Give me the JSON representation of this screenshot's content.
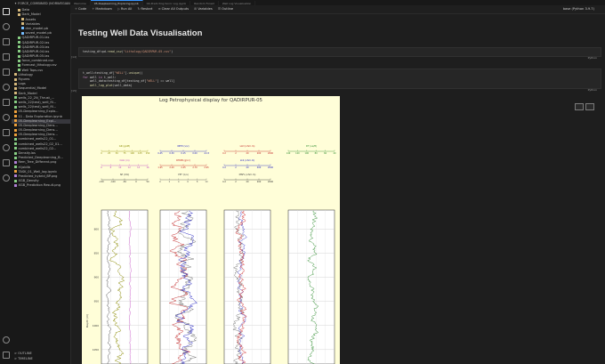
{
  "window": {
    "tabs": [
      {
        "label": "Welcome",
        "active": false
      },
      {
        "label": "05-Deeplearning_Exploring.ipynb",
        "active": true
      },
      {
        "label": "04-Predicting Sonic Log.ipynb",
        "active": false
      },
      {
        "label": "Random Forest",
        "active": false
      },
      {
        "label": "Well Log Visualisation",
        "active": false
      }
    ]
  },
  "toolbar": {
    "code_label": "Code",
    "markdown_label": "Markdown",
    "run_all_label": "Run All",
    "restart_label": "Restart",
    "clear_outputs_label": "Clear All Outputs",
    "variables_label": "Variables",
    "outline_label": "Outline",
    "kernel_label": "base (Python 3.9.7)"
  },
  "sidebar": {
    "title": "✦ FORCE_COMBINED (NORWEGIAN BASE)",
    "items": [
      {
        "label": "Data",
        "indent": 1,
        "color": "#d7ba7d",
        "selected": false
      },
      {
        "label": "Dark_Model",
        "indent": 1,
        "color": "#d7ba7d",
        "selected": false
      },
      {
        "label": "Assets",
        "indent": 2,
        "color": "#d7ba7d",
        "selected": false
      },
      {
        "label": "Variables",
        "indent": 2,
        "color": "#d7ba7d",
        "selected": false
      },
      {
        "label": "dnn_model.pb",
        "indent": 2,
        "color": "#75beff",
        "selected": false
      },
      {
        "label": "saved_model.pb",
        "indent": 2,
        "color": "#75beff",
        "selected": false
      },
      {
        "label": "QADIRPUR-01.las",
        "indent": 1,
        "color": "#89d185",
        "selected": false
      },
      {
        "label": "QADIRPUR-02.las",
        "indent": 1,
        "color": "#89d185",
        "selected": false
      },
      {
        "label": "QADIRPUR-03.las",
        "indent": 1,
        "color": "#89d185",
        "selected": false
      },
      {
        "label": "QADIRPUR-04.las",
        "indent": 1,
        "color": "#89d185",
        "selected": false
      },
      {
        "label": "QADIRPUR-05.las",
        "indent": 1,
        "color": "#89d185",
        "selected": false
      },
      {
        "label": "force_combined.csv",
        "indent": 1,
        "color": "#89d185",
        "selected": false
      },
      {
        "label": "Forecast_lithology.csv",
        "indent": 1,
        "color": "#89d185",
        "selected": false
      },
      {
        "label": "Well Tops.csv",
        "indent": 1,
        "color": "#89d185",
        "selected": false
      },
      {
        "label": "Lithology",
        "indent": 0,
        "color": "#d7ba7d",
        "selected": false
      },
      {
        "label": "Figures",
        "indent": 0,
        "color": "#d7ba7d",
        "selected": false
      },
      {
        "label": "Logs",
        "indent": 0,
        "color": "#d7ba7d",
        "selected": false
      },
      {
        "label": "Sequential_Model",
        "indent": 0,
        "color": "#d7ba7d",
        "selected": false
      },
      {
        "label": "Dark_Model",
        "indent": 0,
        "color": "#d7ba7d",
        "selected": false
      },
      {
        "label": "wells_22_2N_Thrust_...",
        "indent": 0,
        "color": "#89d185",
        "selected": false
      },
      {
        "label": "wells_22(test)_well_fil...",
        "indent": 0,
        "color": "#89d185",
        "selected": false
      },
      {
        "label": "wells_22(test)_well_fil...",
        "indent": 0,
        "color": "#89d185",
        "selected": false
      },
      {
        "label": "05-Deeplearning_Explo...",
        "indent": 0,
        "color": "#f0a23b",
        "selected": false
      },
      {
        "label": "11 - Data Exploration.ipynb",
        "indent": 0,
        "color": "#f0a23b",
        "selected": false
      },
      {
        "label": "05-Deeplearning_Expl...",
        "indent": 0,
        "color": "#f0a23b",
        "selected": true
      },
      {
        "label": "05-Deeplearning_Dens...",
        "indent": 0,
        "color": "#f0a23b",
        "selected": false
      },
      {
        "label": "05-Deeplearning_Dens...",
        "indent": 0,
        "color": "#f0a23b",
        "selected": false
      },
      {
        "label": "05-Deeplearning_Dens...",
        "indent": 0,
        "color": "#f0a23b",
        "selected": false
      },
      {
        "label": "combined_wells22_01...",
        "indent": 0,
        "color": "#89d185",
        "selected": false
      },
      {
        "label": "combined_wells22_02_01...",
        "indent": 0,
        "color": "#89d185",
        "selected": false
      },
      {
        "label": "combined_wells22_02...",
        "indent": 0,
        "color": "#89d185",
        "selected": false
      },
      {
        "label": "Density.las",
        "indent": 0,
        "color": "#89d185",
        "selected": false
      },
      {
        "label": "Predicted_Deeplearning_B...",
        "indent": 0,
        "color": "#89d185",
        "selected": false
      },
      {
        "label": "Rem_Tree_Different.png",
        "indent": 0,
        "color": "#b180d7",
        "selected": false
      },
      {
        "label": "rf.joblib",
        "indent": 0,
        "color": "#89d185",
        "selected": false
      },
      {
        "label": "TASK_01_Well_log.ipynb",
        "indent": 0,
        "color": "#f0a23b",
        "selected": false
      },
      {
        "label": "Predicted_hybrid_BP.png",
        "indent": 0,
        "color": "#b180d7",
        "selected": false
      },
      {
        "label": "XGB_Density",
        "indent": 0,
        "color": "#89d185",
        "selected": false
      },
      {
        "label": "XGB_Prediction Result.png",
        "indent": 0,
        "color": "#b180d7",
        "selected": false
      }
    ],
    "outline_label": "> OUTLINE",
    "timeline_label": "> TIMELINE"
  },
  "notebook": {
    "heading": "Testing Well Data Visualisation",
    "cells": [
      {
        "exec_count": "[14]",
        "lines": [
          "testing_df=pd.read_csv(\"Lithology/QADIRPUR-05.csv\")"
        ],
        "lang": "Python"
      },
      {
        "exec_count": "[15]",
        "lines": [
          "t_well=testing_df[\"WELL\"].unique()",
          "for well in t_well:",
          "    well_data=testing_df[testing_df[\"WELL\"] == well]",
          "    well_log_plot(well_data)"
        ],
        "lang": "Python"
      }
    ]
  },
  "chart_data": {
    "type": "line",
    "title": "Log Petrophysical display for QADIRPUR-05",
    "ylabel": "Depth (m)",
    "y_ticks": [
      "800",
      "850",
      "900",
      "950",
      "1000",
      "1050"
    ],
    "depth_range": [
      760,
      1080
    ],
    "grid": true,
    "tracks": [
      {
        "top_scales": [
          {
            "name": "GR (gAPI)",
            "color": "#8a8a00",
            "ticks": [
              "0",
              "25",
              "50",
              "75",
              "100",
              "125",
              "150"
            ]
          },
          {
            "name": "CALI (in)",
            "color": "#c040c0",
            "ticks": [
              "6",
              "8",
              "10",
              "12",
              "14",
              "16"
            ]
          },
          {
            "name": "SP (mV)",
            "color": "#333333",
            "ticks": [
              "-150",
              "-100",
              "-50",
              "0",
              "50"
            ]
          }
        ]
      },
      {
        "top_scales": [
          {
            "name": "NPHI (v/v)",
            "color": "#2020c0",
            "ticks": [
              "0.45",
              "0.30",
              "0.15",
              "0.00",
              "-0.15"
            ]
          },
          {
            "name": "RHOB (g/cc)",
            "color": "#c02020",
            "ticks": [
              "1.95",
              "2.20",
              "2.45",
              "2.70",
              "2.95"
            ]
          },
          {
            "name": "PEF (b/e)",
            "color": "#555555",
            "ticks": [
              "0",
              "2",
              "4",
              "6",
              "8",
              "10"
            ]
          }
        ]
      },
      {
        "top_scales": [
          {
            "name": "LLD (ohm.m)",
            "color": "#c02020",
            "ticks": [
              "0.2",
              "2",
              "20",
              "200",
              "2000"
            ]
          },
          {
            "name": "LLS (ohm.m)",
            "color": "#2020c0",
            "ticks": [
              "0.2",
              "2",
              "20",
              "200",
              "2000"
            ]
          },
          {
            "name": "MSFL (ohm.m)",
            "color": "#333333",
            "ticks": [
              "0.2",
              "2",
              "20",
              "200",
              "2000"
            ]
          }
        ]
      },
      {
        "top_scales": [
          {
            "name": "DT (us/ft)",
            "color": "#2a8a2a",
            "ticks": [
              "140",
              "120",
              "100",
              "80",
              "60",
              "40"
            ]
          }
        ]
      }
    ],
    "series_colors": {
      "GR": "#8a8a00",
      "CALI": "#c040c0",
      "SP": "#222222",
      "NPHI": "#2020c0",
      "RHOB": "#c02020",
      "PEF": "#222222",
      "LLD": "#d02020",
      "LLS": "#2020c0",
      "MSFL": "#222222",
      "DT": "#2a8a2a"
    }
  }
}
